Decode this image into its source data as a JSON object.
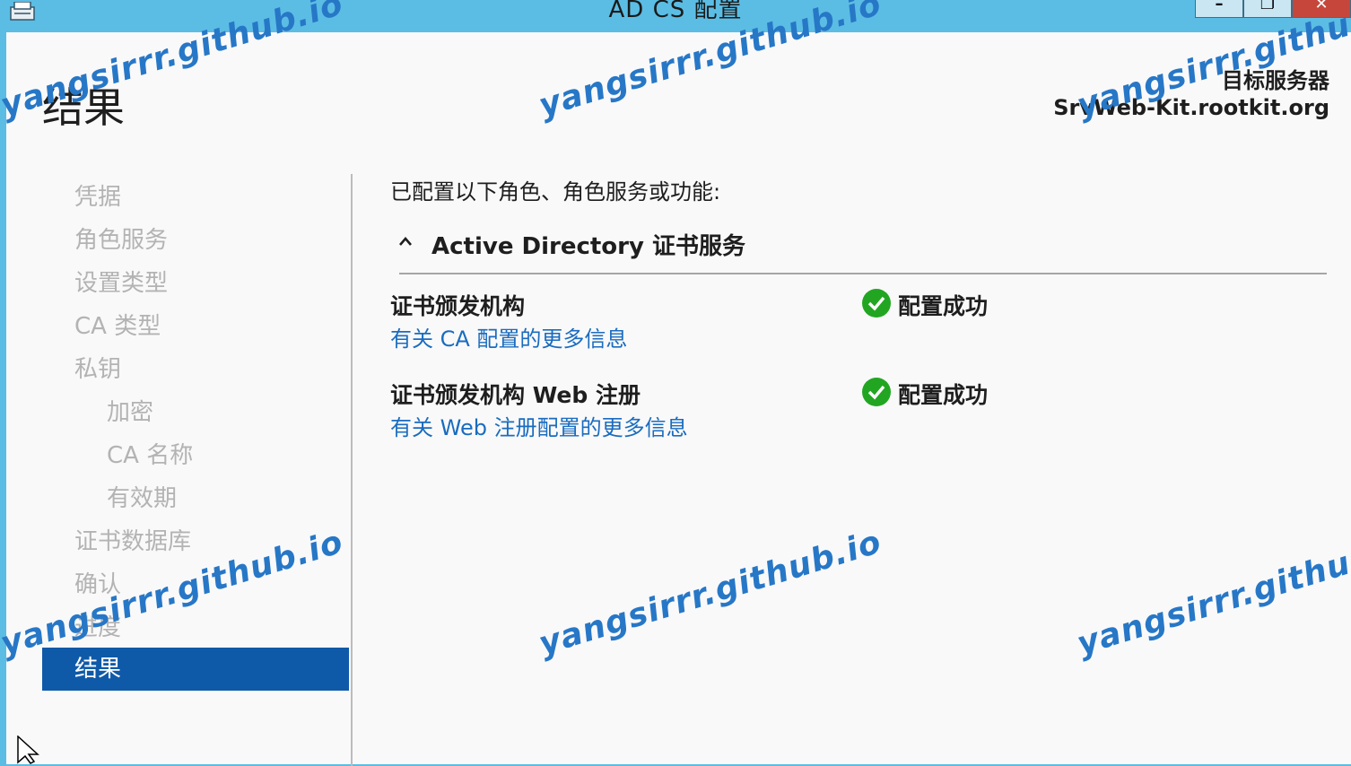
{
  "window": {
    "title": "AD CS 配置",
    "minimize_glyph": "–",
    "maximize_glyph": "❐",
    "close_glyph": "✕"
  },
  "header": {
    "page_title": "结果",
    "target_label": "目标服务器",
    "target_value": "SrvWeb-Kit.rootkit.org"
  },
  "sidebar": {
    "items": [
      {
        "label": "凭据",
        "level": 0,
        "active": false
      },
      {
        "label": "角色服务",
        "level": 0,
        "active": false
      },
      {
        "label": "设置类型",
        "level": 0,
        "active": false
      },
      {
        "label": "CA 类型",
        "level": 0,
        "active": false
      },
      {
        "label": "私钥",
        "level": 0,
        "active": false
      },
      {
        "label": "加密",
        "level": 1,
        "active": false
      },
      {
        "label": "CA 名称",
        "level": 1,
        "active": false
      },
      {
        "label": "有效期",
        "level": 1,
        "active": false
      },
      {
        "label": "证书数据库",
        "level": 0,
        "active": false
      },
      {
        "label": "确认",
        "level": 0,
        "active": false
      },
      {
        "label": "进度",
        "level": 0,
        "active": false
      },
      {
        "label": "结果",
        "level": 0,
        "active": true
      }
    ]
  },
  "main": {
    "intro": "已配置以下角色、角色服务或功能:",
    "section_title": "Active Directory 证书服务",
    "rows": [
      {
        "name": "证书颁发机构",
        "link": "有关 CA 配置的更多信息",
        "status": "配置成功"
      },
      {
        "name": "证书颁发机构 Web 注册",
        "link": "有关 Web 注册配置的更多信息",
        "status": "配置成功"
      }
    ]
  },
  "watermark": "yangsirrr.github.io",
  "colors": {
    "titlebar": "#5bbde4",
    "active_nav": "#0f5aa8",
    "link": "#1a6cbf",
    "success": "#22a622",
    "close_button": "#c7463b",
    "watermark": "#2777c7"
  }
}
